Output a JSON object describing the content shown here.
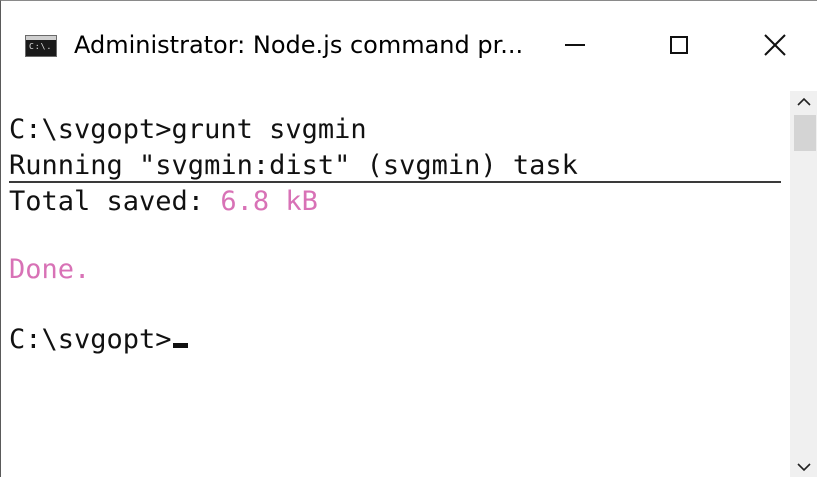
{
  "window": {
    "title": "Administrator: Node.js command pr...",
    "app_icon": "cmd-icon",
    "app_icon_text": "C:\\."
  },
  "controls": {
    "minimize_icon": "minimize-icon",
    "maximize_icon": "maximize-icon",
    "close_icon": "close-icon"
  },
  "console": {
    "line1": "C:\\svgopt>grunt svgmin",
    "line2": "Running \"svgmin:dist\" (svgmin) task",
    "line3_label": "Total saved: ",
    "line3_value": "6.8 kB",
    "line4": "Done.",
    "prompt": "C:\\svgopt>",
    "highlight_color": "#d872b6"
  },
  "scrollbar": {
    "up_icon": "chevron-up-icon",
    "down_icon": "chevron-down-icon"
  }
}
